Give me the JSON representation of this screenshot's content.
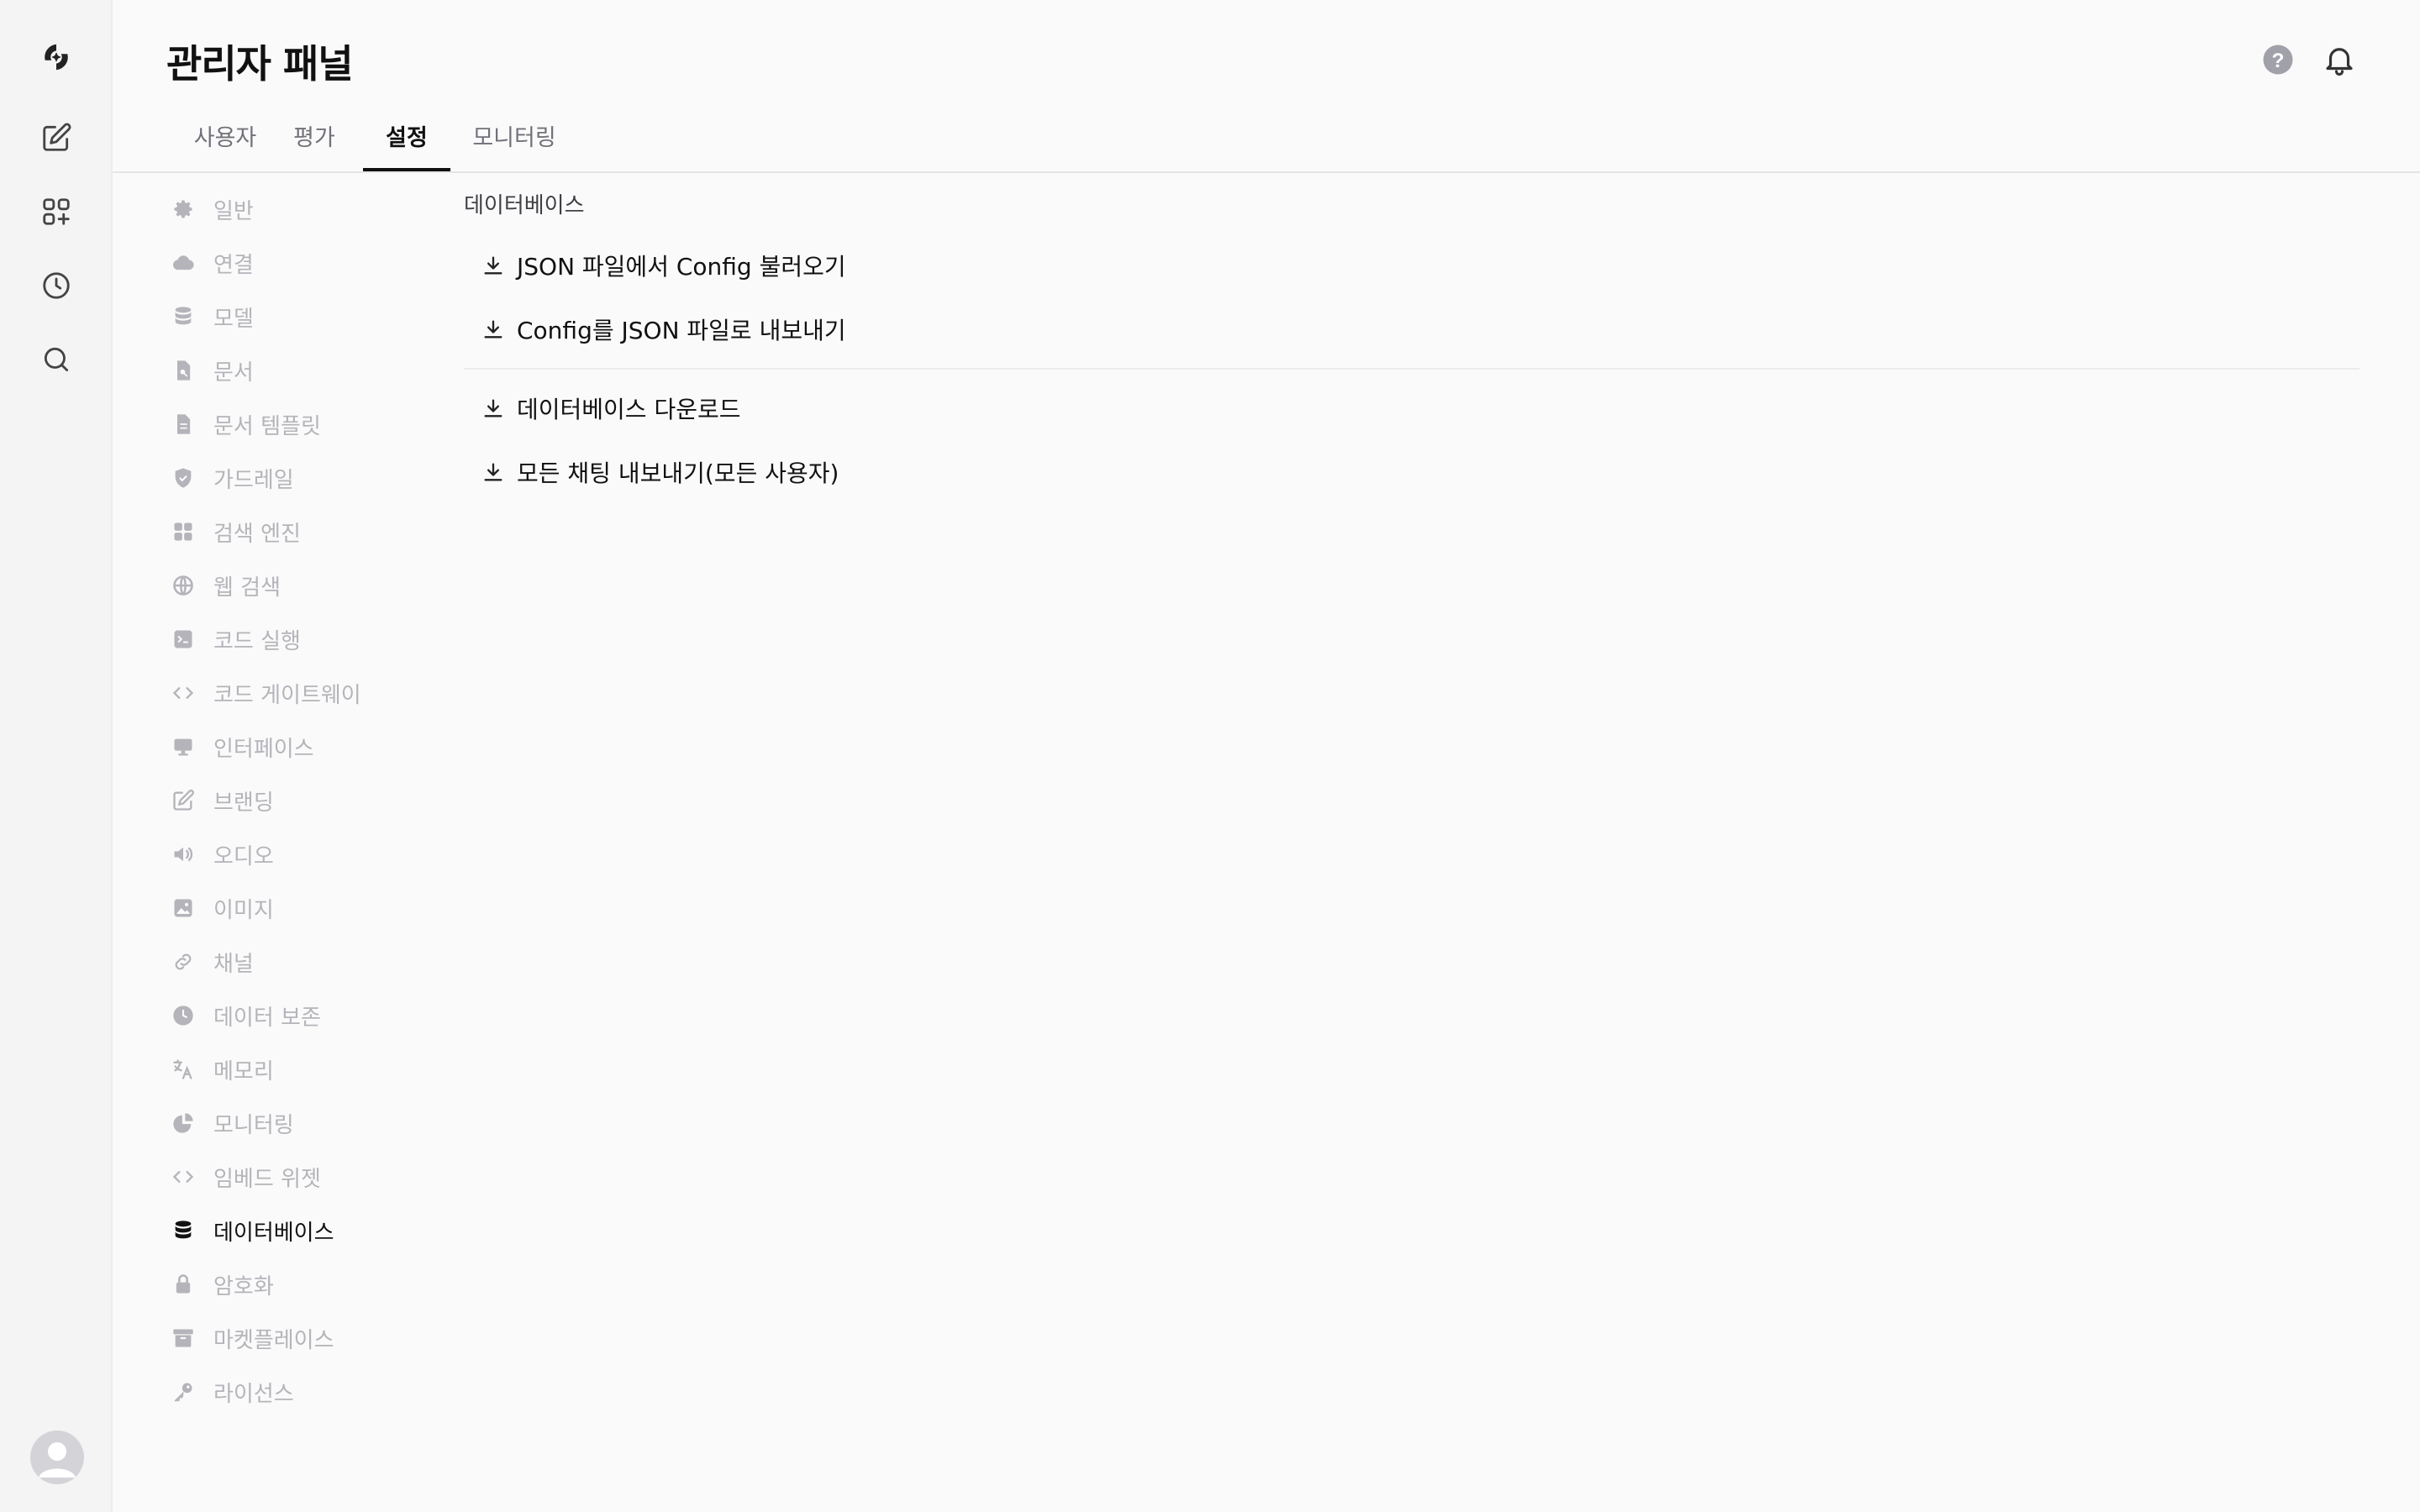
{
  "header": {
    "title": "관리자 패널"
  },
  "tabs": [
    {
      "label": "사용자"
    },
    {
      "label": "평가"
    },
    {
      "label": "설정"
    },
    {
      "label": "모니터링"
    }
  ],
  "active_tab": "설정",
  "sidebar": {
    "items": [
      {
        "label": "일반",
        "icon": "gear-icon"
      },
      {
        "label": "연결",
        "icon": "cloud-icon"
      },
      {
        "label": "모델",
        "icon": "database-icon"
      },
      {
        "label": "문서",
        "icon": "document-search-icon"
      },
      {
        "label": "문서 템플릿",
        "icon": "document-icon"
      },
      {
        "label": "가드레일",
        "icon": "shield-icon"
      },
      {
        "label": "검색 엔진",
        "icon": "grid-icon"
      },
      {
        "label": "웹 검색",
        "icon": "globe-icon"
      },
      {
        "label": "코드 실행",
        "icon": "terminal-icon"
      },
      {
        "label": "코드 게이트웨이",
        "icon": "code-icon"
      },
      {
        "label": "인터페이스",
        "icon": "monitor-icon"
      },
      {
        "label": "브랜딩",
        "icon": "edit-icon"
      },
      {
        "label": "오디오",
        "icon": "speaker-icon"
      },
      {
        "label": "이미지",
        "icon": "image-icon"
      },
      {
        "label": "채널",
        "icon": "link-icon"
      },
      {
        "label": "데이터 보존",
        "icon": "clock-icon"
      },
      {
        "label": "메모리",
        "icon": "translate-icon"
      },
      {
        "label": "모니터링",
        "icon": "chart-icon"
      },
      {
        "label": "임베드 위젯",
        "icon": "code-icon"
      },
      {
        "label": "데이터베이스",
        "icon": "database-icon"
      },
      {
        "label": "암호화",
        "icon": "lock-icon"
      },
      {
        "label": "마켓플레이스",
        "icon": "archive-icon"
      },
      {
        "label": "라이선스",
        "icon": "key-icon"
      }
    ],
    "active": "데이터베이스"
  },
  "main": {
    "section_title": "데이터베이스",
    "actions": [
      {
        "label": "JSON 파일에서 Config 불러오기",
        "icon": "download-icon"
      },
      {
        "label": "Config를 JSON 파일로 내보내기",
        "icon": "download-icon"
      },
      {
        "label": "데이터베이스 다운로드",
        "icon": "download-icon"
      },
      {
        "label": "모든 채팅 내보내기(모든 사용자)",
        "icon": "download-icon"
      }
    ]
  },
  "colors": {
    "accent": "#111111",
    "muted_text": "#b4b4ba",
    "tab_inactive": "#71717a",
    "background": "#fafafa",
    "rail_background": "#f4f4f5"
  }
}
